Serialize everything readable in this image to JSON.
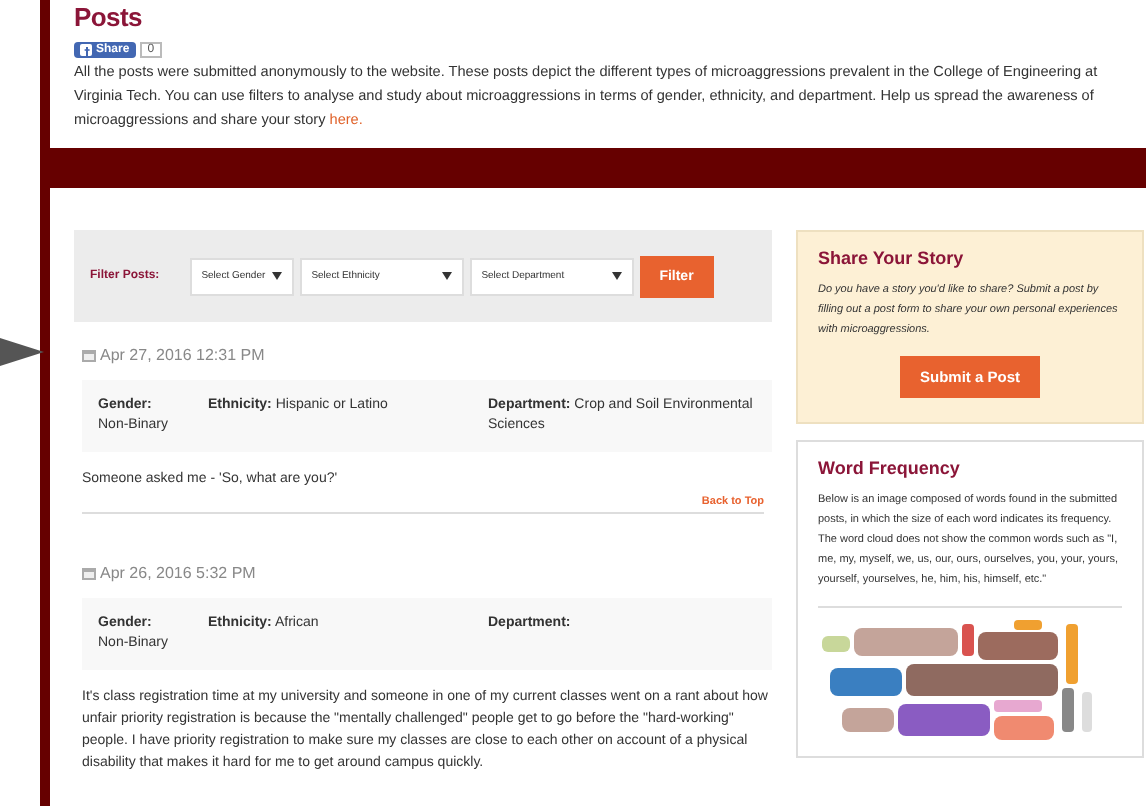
{
  "header": {
    "title": "Posts",
    "share_label": "Share",
    "share_count": "0",
    "intro": "All the posts were submitted anonymously to the website. These posts depict the different types of microaggressions prevalent in the College of Engineering at Virginia Tech. You can use filters to analyse and study about microaggressions in terms of gender, ethnicity, and department. Help us spread the awareness of microaggressions and share your story ",
    "intro_link": "here."
  },
  "filter": {
    "label": "Filter Posts:",
    "selects": [
      "Select Gender",
      "Select Ethnicity",
      "Select Department"
    ],
    "button": "Filter"
  },
  "posts": [
    {
      "date": "Apr 27, 2016 12:31 PM",
      "gender_label": "Gender:",
      "gender": "Non-Binary",
      "ethnicity_label": "Ethnicity:",
      "ethnicity": "Hispanic or Latino",
      "department_label": "Department:",
      "department": "Crop and Soil Environmental Sciences",
      "text": "Someone asked me - 'So, what are you?'",
      "back_to_top": "Back to Top"
    },
    {
      "date": "Apr 26, 2016 5:32 PM",
      "gender_label": "Gender:",
      "gender": "Non-Binary",
      "ethnicity_label": "Ethnicity:",
      "ethnicity": "African",
      "department_label": "Department:",
      "text": "It's class registration time at my university and someone in one of my current classes went on a rant about how unfair priority registration is because the \"mentally challenged\" people get to go before the \"hard-working\" people. I have priority registration to make sure my classes are close to each other on account of a physical disability that makes it hard for me to get around campus quickly."
    }
  ],
  "sidebar": {
    "share": {
      "title": "Share Your Story",
      "text": "Do you have a story you'd like to share? Submit a post by filling out a post form to share your own personal experiences with microaggressions.",
      "button": "Submit a Post"
    },
    "words": {
      "title": "Word Frequency",
      "text": "Below is an image composed of words found in the submitted posts, in which the size of each word indicates its frequency. The word cloud does not show the common words such as \"I, me, my, myself, we, us, our, ours, ourselves, you, your, yours, yourself, yourselves, he, him, his, himself, etc.\""
    }
  }
}
